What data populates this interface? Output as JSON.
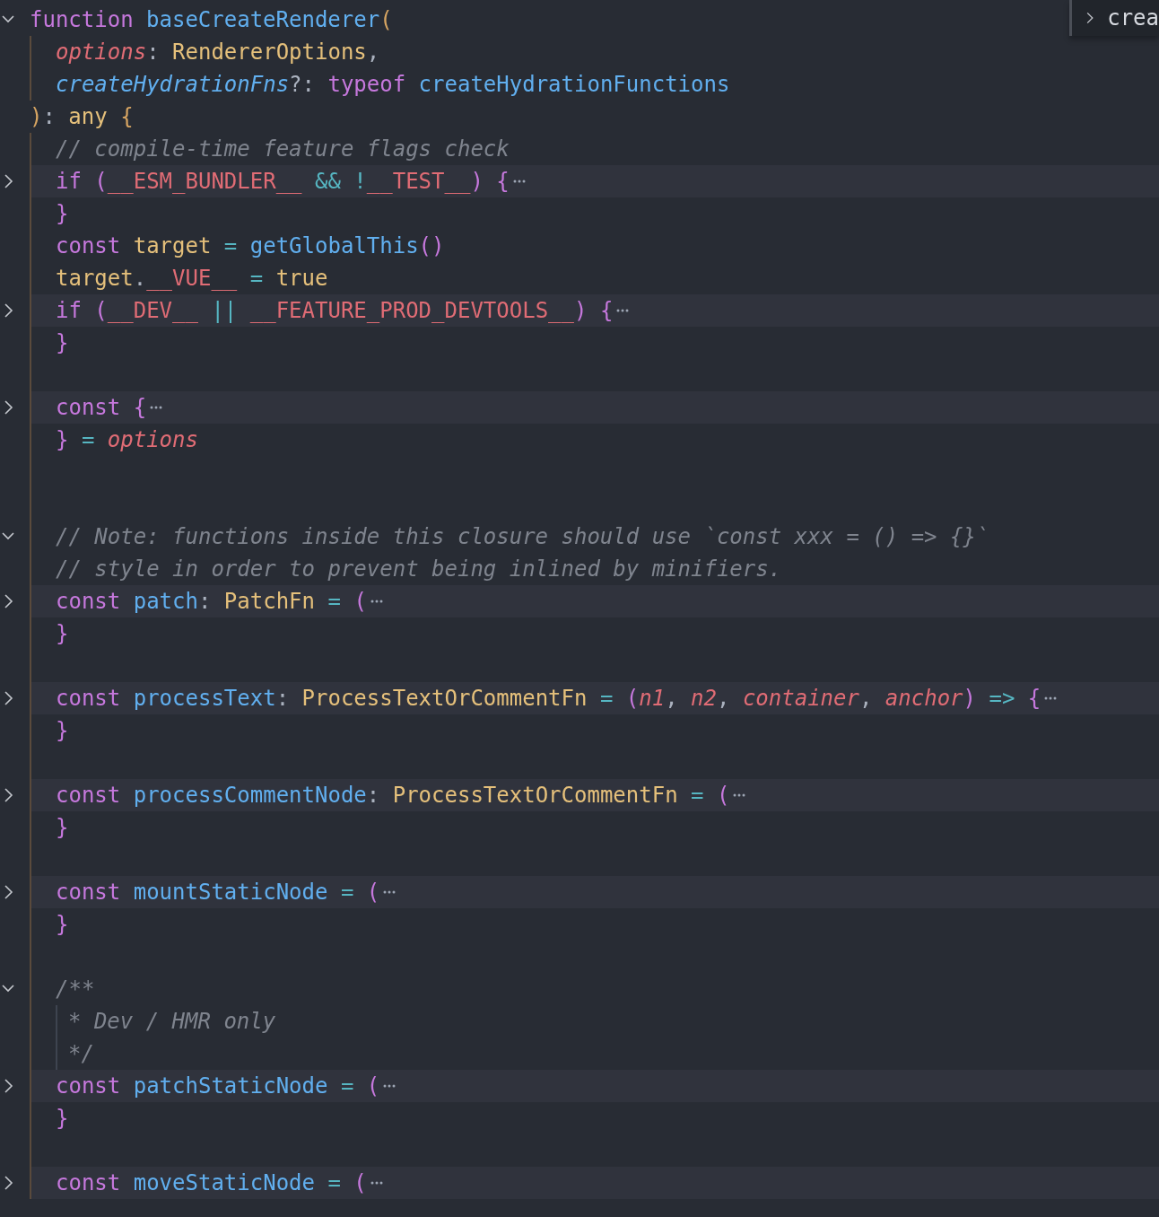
{
  "editor": {
    "lines": [
      {
        "kind": "code",
        "indented": false,
        "expanded": true,
        "tokens": [
          {
            "text": "function ",
            "kind": "keyword"
          },
          {
            "text": "baseCreateRenderer",
            "kind": "function"
          },
          {
            "text": "(",
            "kind": "bracket_outer"
          }
        ]
      },
      {
        "kind": "code",
        "indented": true,
        "tokens": [
          {
            "text": "options",
            "kind": "parameter"
          },
          {
            "text": ": ",
            "kind": "punct"
          },
          {
            "text": "RendererOptions",
            "kind": "type"
          },
          {
            "text": ",",
            "kind": "punct"
          }
        ]
      },
      {
        "kind": "code",
        "indented": true,
        "tokens": [
          {
            "text": "createHydrationFns",
            "kind": "function_italic"
          },
          {
            "text": "?: ",
            "kind": "punct"
          },
          {
            "text": "typeof ",
            "kind": "keyword"
          },
          {
            "text": "createHydrationFunctions",
            "kind": "function"
          }
        ]
      },
      {
        "kind": "code",
        "indented": false,
        "tokens": [
          {
            "text": ")",
            "kind": "bracket_outer"
          },
          {
            "text": ": ",
            "kind": "punct"
          },
          {
            "text": "any ",
            "kind": "type"
          },
          {
            "text": "{",
            "kind": "bracket_outer"
          }
        ]
      },
      {
        "kind": "code",
        "indented": true,
        "tokens": [
          {
            "text": "// compile-time feature flags check",
            "kind": "comment"
          }
        ]
      },
      {
        "kind": "code",
        "indented": true,
        "expanded": false,
        "tokens": [
          {
            "text": "if ",
            "kind": "keyword"
          },
          {
            "text": "(",
            "kind": "bracket"
          },
          {
            "text": "__ESM_BUNDLER__",
            "kind": "constant"
          },
          {
            "text": " && !",
            "kind": "operator"
          },
          {
            "text": "__TEST__",
            "kind": "constant"
          },
          {
            "text": ") {",
            "kind": "bracket"
          }
        ]
      },
      {
        "kind": "code",
        "indented": true,
        "tokens": [
          {
            "text": "}",
            "kind": "bracket"
          }
        ]
      },
      {
        "kind": "code",
        "indented": true,
        "tokens": [
          {
            "text": "const ",
            "kind": "keyword"
          },
          {
            "text": "target",
            "kind": "variable"
          },
          {
            "text": " = ",
            "kind": "operator"
          },
          {
            "text": "getGlobalThis",
            "kind": "function"
          },
          {
            "text": "()",
            "kind": "bracket"
          }
        ]
      },
      {
        "kind": "code",
        "indented": true,
        "tokens": [
          {
            "text": "target",
            "kind": "variable"
          },
          {
            "text": ".",
            "kind": "punct"
          },
          {
            "text": "__VUE__",
            "kind": "constant"
          },
          {
            "text": " = ",
            "kind": "operator"
          },
          {
            "text": "true",
            "kind": "boolean"
          }
        ]
      },
      {
        "kind": "code",
        "indented": true,
        "expanded": false,
        "tokens": [
          {
            "text": "if ",
            "kind": "keyword"
          },
          {
            "text": "(",
            "kind": "bracket"
          },
          {
            "text": "__DEV__",
            "kind": "constant"
          },
          {
            "text": " || ",
            "kind": "operator"
          },
          {
            "text": "__FEATURE_PROD_DEVTOOLS__",
            "kind": "constant"
          },
          {
            "text": ") {",
            "kind": "bracket"
          }
        ]
      },
      {
        "kind": "code",
        "indented": true,
        "tokens": [
          {
            "text": "}",
            "kind": "bracket"
          }
        ]
      },
      {
        "kind": "blank"
      },
      {
        "kind": "code",
        "indented": true,
        "expanded": false,
        "tokens": [
          {
            "text": "const ",
            "kind": "keyword"
          },
          {
            "text": "{",
            "kind": "bracket"
          }
        ]
      },
      {
        "kind": "code",
        "indented": true,
        "tokens": [
          {
            "text": "}",
            "kind": "bracket"
          },
          {
            "text": " = ",
            "kind": "operator"
          },
          {
            "text": "options",
            "kind": "parameter"
          }
        ]
      },
      {
        "kind": "blank"
      },
      {
        "kind": "blank"
      },
      {
        "kind": "code",
        "indented": true,
        "expanded": true,
        "tokens": [
          {
            "text": "// Note: functions inside this closure should use `const xxx = () => {}`",
            "kind": "comment"
          }
        ]
      },
      {
        "kind": "code",
        "indented": true,
        "tokens": [
          {
            "text": "// style in order to prevent being inlined by minifiers.",
            "kind": "comment"
          }
        ]
      },
      {
        "kind": "code",
        "indented": true,
        "expanded": false,
        "tokens": [
          {
            "text": "const ",
            "kind": "keyword"
          },
          {
            "text": "patch",
            "kind": "function"
          },
          {
            "text": ": ",
            "kind": "punct"
          },
          {
            "text": "PatchFn",
            "kind": "type"
          },
          {
            "text": " = ",
            "kind": "operator"
          },
          {
            "text": "(",
            "kind": "bracket"
          }
        ]
      },
      {
        "kind": "code",
        "indented": true,
        "tokens": [
          {
            "text": "}",
            "kind": "bracket"
          }
        ]
      },
      {
        "kind": "blank"
      },
      {
        "kind": "code",
        "indented": true,
        "expanded": false,
        "tokens": [
          {
            "text": "const ",
            "kind": "keyword"
          },
          {
            "text": "processText",
            "kind": "function"
          },
          {
            "text": ": ",
            "kind": "punct"
          },
          {
            "text": "ProcessTextOrCommentFn",
            "kind": "type"
          },
          {
            "text": " = ",
            "kind": "operator"
          },
          {
            "text": "(",
            "kind": "bracket"
          },
          {
            "text": "n1",
            "kind": "parameter"
          },
          {
            "text": ", ",
            "kind": "punct"
          },
          {
            "text": "n2",
            "kind": "parameter"
          },
          {
            "text": ", ",
            "kind": "punct"
          },
          {
            "text": "container",
            "kind": "parameter"
          },
          {
            "text": ", ",
            "kind": "punct"
          },
          {
            "text": "anchor",
            "kind": "parameter"
          },
          {
            "text": ")",
            "kind": "bracket"
          },
          {
            "text": " => ",
            "kind": "operator"
          },
          {
            "text": "{",
            "kind": "bracket"
          }
        ]
      },
      {
        "kind": "code",
        "indented": true,
        "tokens": [
          {
            "text": "}",
            "kind": "bracket"
          }
        ]
      },
      {
        "kind": "blank"
      },
      {
        "kind": "code",
        "indented": true,
        "expanded": false,
        "tokens": [
          {
            "text": "const ",
            "kind": "keyword"
          },
          {
            "text": "processCommentNode",
            "kind": "function"
          },
          {
            "text": ": ",
            "kind": "punct"
          },
          {
            "text": "ProcessTextOrCommentFn",
            "kind": "type"
          },
          {
            "text": " = ",
            "kind": "operator"
          },
          {
            "text": "(",
            "kind": "bracket"
          }
        ]
      },
      {
        "kind": "code",
        "indented": true,
        "tokens": [
          {
            "text": "}",
            "kind": "bracket"
          }
        ]
      },
      {
        "kind": "blank"
      },
      {
        "kind": "code",
        "indented": true,
        "expanded": false,
        "tokens": [
          {
            "text": "const ",
            "kind": "keyword"
          },
          {
            "text": "mountStaticNode",
            "kind": "function"
          },
          {
            "text": " = ",
            "kind": "operator"
          },
          {
            "text": "(",
            "kind": "bracket"
          }
        ]
      },
      {
        "kind": "code",
        "indented": true,
        "tokens": [
          {
            "text": "}",
            "kind": "bracket"
          }
        ]
      },
      {
        "kind": "blank"
      },
      {
        "kind": "code",
        "indented": true,
        "expanded": true,
        "tokens": [
          {
            "text": "/**",
            "kind": "comment"
          }
        ]
      },
      {
        "kind": "doc",
        "indented": true,
        "tokens": [
          {
            "text": "* Dev / HMR only",
            "kind": "comment"
          }
        ]
      },
      {
        "kind": "doc",
        "indented": true,
        "tokens": [
          {
            "text": "*/",
            "kind": "comment"
          }
        ]
      },
      {
        "kind": "code",
        "indented": true,
        "expanded": false,
        "tokens": [
          {
            "text": "const ",
            "kind": "keyword"
          },
          {
            "text": "patchStaticNode",
            "kind": "function"
          },
          {
            "text": " = ",
            "kind": "operator"
          },
          {
            "text": "(",
            "kind": "bracket"
          }
        ]
      },
      {
        "kind": "code",
        "indented": true,
        "tokens": [
          {
            "text": "}",
            "kind": "bracket"
          }
        ]
      },
      {
        "kind": "blank"
      },
      {
        "kind": "code",
        "indented": true,
        "expanded": false,
        "tokens": [
          {
            "text": "const ",
            "kind": "keyword"
          },
          {
            "text": "moveStaticNode",
            "kind": "function"
          },
          {
            "text": " = ",
            "kind": "operator"
          },
          {
            "text": "(",
            "kind": "bracket"
          }
        ]
      }
    ]
  },
  "sticky_scroll": {
    "text": "crea"
  }
}
